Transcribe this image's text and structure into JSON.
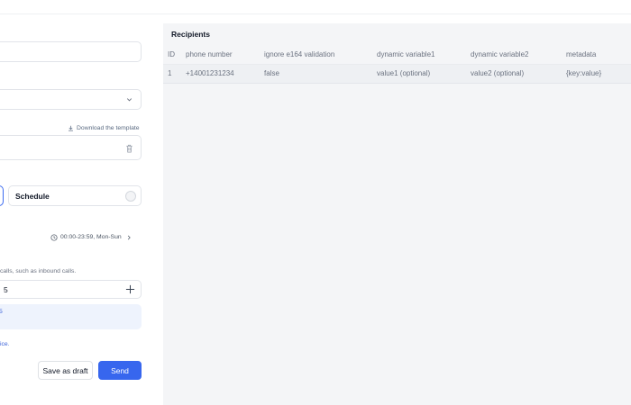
{
  "form": {
    "download_template_label": "Download the template",
    "type_option_label": "Schedule",
    "schedule_time": "00:00-23:59, Mon-Sun",
    "concurrency_hint": "calls, such as inbound calls.",
    "concurrency_value": "5",
    "concurrency_info": "5",
    "footer_link_text": "ice.",
    "save_draft_label": "Save as draft",
    "send_label": "Send"
  },
  "recipients": {
    "title": "Recipients",
    "columns": [
      "ID",
      "phone number",
      "ignore e164 validation",
      "dynamic variable1",
      "dynamic variable2",
      "metadata"
    ],
    "rows": [
      [
        "1",
        "+14001231234",
        "false",
        "value1 (optional)",
        "value2 (optional)",
        "{key:value}"
      ]
    ]
  },
  "colors": {
    "primary": "#3766ee",
    "panel_bg": "#f4f5f7",
    "info_bg": "#eef3fd",
    "link": "#3d63d9"
  }
}
